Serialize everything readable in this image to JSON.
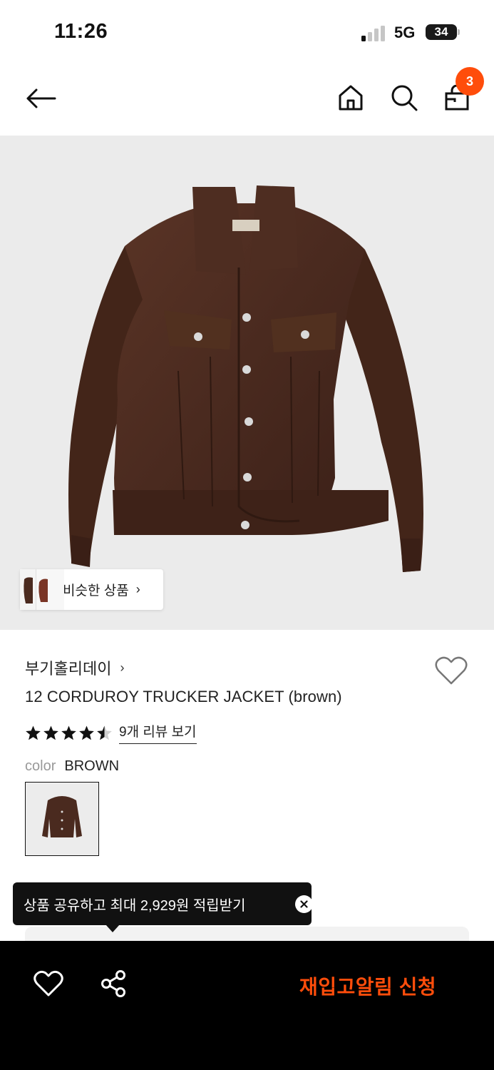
{
  "status_bar": {
    "time": "11:26",
    "network": "5G",
    "battery": "34"
  },
  "nav": {
    "cart_count": "3",
    "icons": [
      "back-arrow-icon",
      "home-icon",
      "search-icon",
      "shopping-bag-icon"
    ]
  },
  "hero": {
    "similar_label": "비슷한 상품",
    "similar_chevron": "›"
  },
  "product": {
    "brand": "부기홀리데이",
    "brand_chevron": "›",
    "title": "12 CORDUROY TRUCKER JACKET (brown)",
    "rating_stars": 4.5,
    "review_link": "9개 리뷰 보기",
    "color_label": "color",
    "color_value": "BROWN"
  },
  "tooltip": {
    "text": "상품 공유하고 최대 2,929원 적립받기"
  },
  "bottom_bar": {
    "restock_label": "재입고알림 신청"
  },
  "colors": {
    "accent": "#ff4d0b",
    "jacket": "#4a2a1f",
    "hero_bg": "#ebebeb"
  }
}
